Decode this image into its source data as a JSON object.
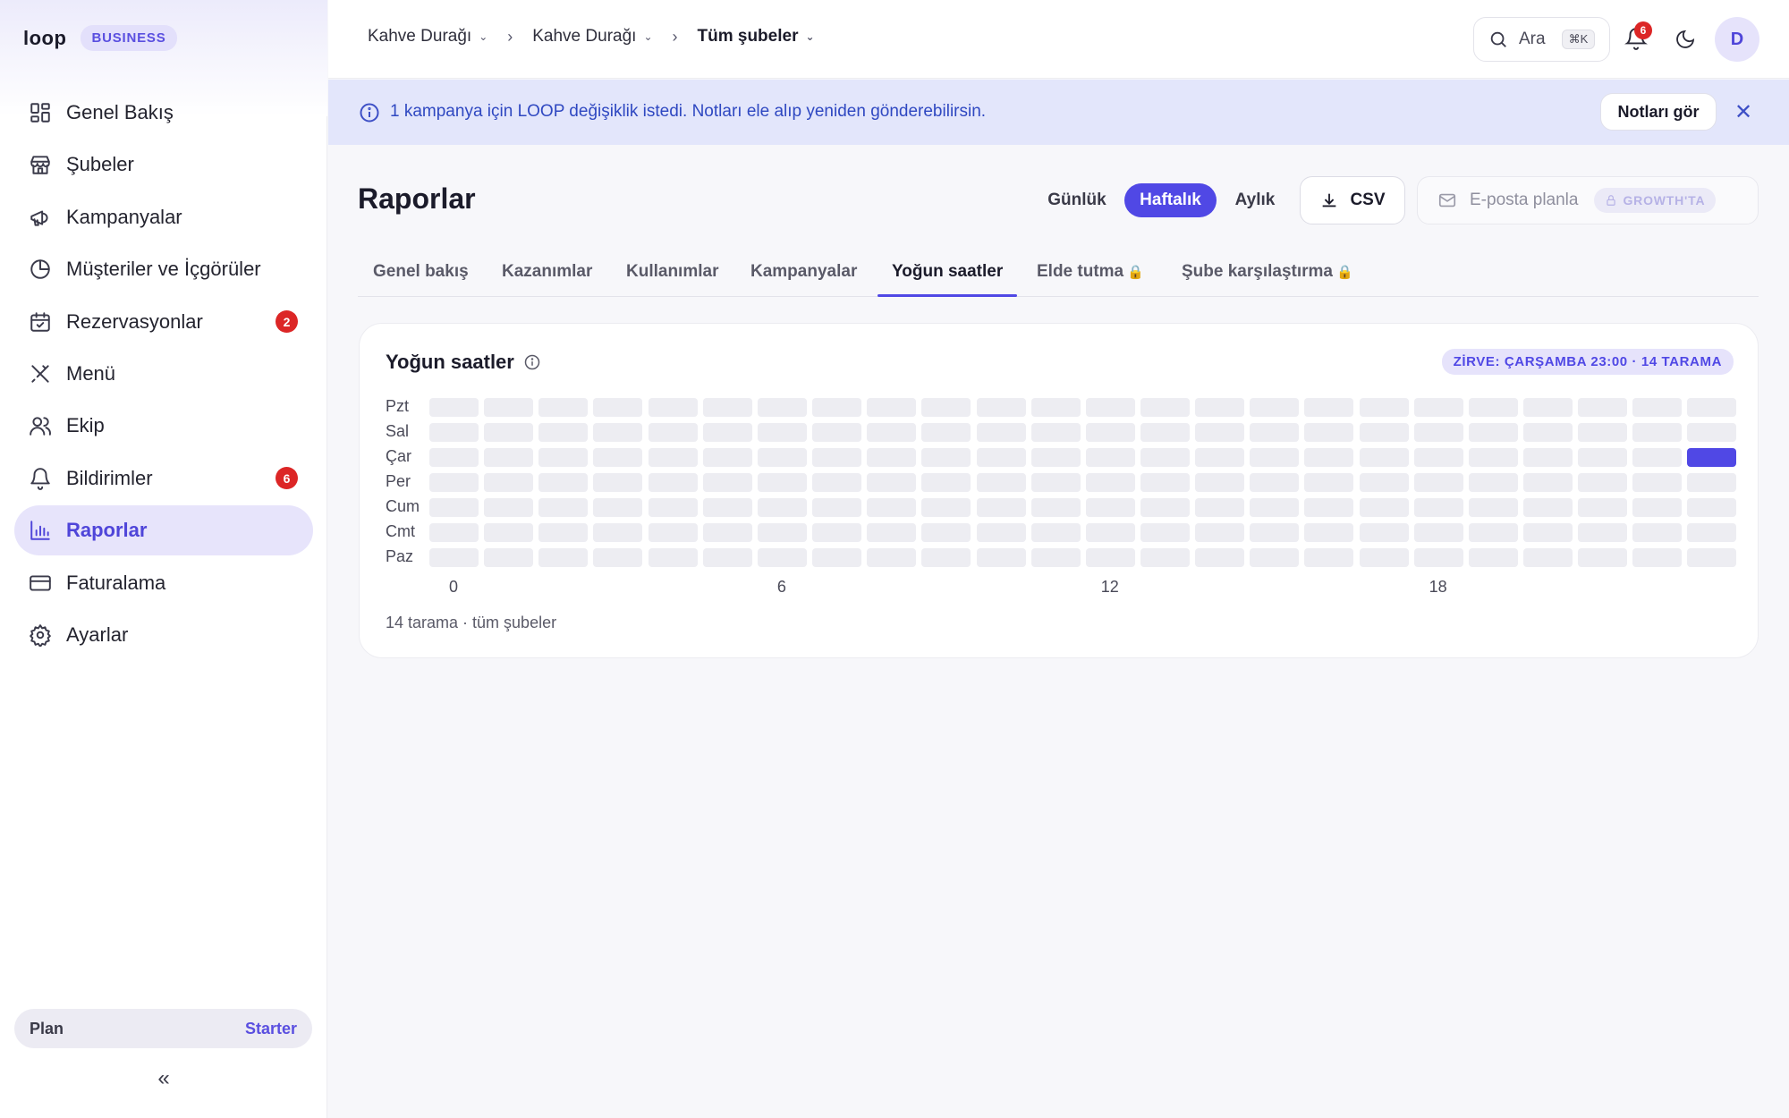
{
  "sidebar": {
    "logo": "loop",
    "badge": "BUSINESS",
    "items": [
      {
        "label": "Genel Bakış",
        "icon": "grid-icon"
      },
      {
        "label": "Şubeler",
        "icon": "store-icon"
      },
      {
        "label": "Kampanyalar",
        "icon": "megaphone-icon"
      },
      {
        "label": "Müşteriler ve İçgörüler",
        "icon": "pie-chart-icon"
      },
      {
        "label": "Rezervasyonlar",
        "icon": "calendar-check-icon",
        "badge": "2"
      },
      {
        "label": "Menü",
        "icon": "utensils-icon"
      },
      {
        "label": "Ekip",
        "icon": "users-icon"
      },
      {
        "label": "Bildirimler",
        "icon": "bell-icon",
        "badge": "6"
      },
      {
        "label": "Raporlar",
        "icon": "bar-chart-icon",
        "active": true
      },
      {
        "label": "Faturalama",
        "icon": "credit-card-icon"
      },
      {
        "label": "Ayarlar",
        "icon": "gear-icon"
      }
    ],
    "plan_label": "Plan",
    "plan_value": "Starter",
    "collapse": "«"
  },
  "topbar": {
    "breadcrumbs": [
      "Kahve Durağı",
      "Kahve Durağı",
      "Tüm şubeler"
    ],
    "search_label": "Ara",
    "search_shortcut": "⌘K",
    "notifications_count": "6",
    "avatar_initial": "D"
  },
  "banner": {
    "text": "1 kampanya için LOOP değişiklik istedi. Notları ele alıp yeniden gönderebilirsin.",
    "button": "Notları gör"
  },
  "page": {
    "title": "Raporlar",
    "periods": [
      "Günlük",
      "Haftalık",
      "Aylık"
    ],
    "active_period": "Haftalık",
    "csv_label": "CSV",
    "email_label": "E-posta planla",
    "email_badge": "GROWTH'TA",
    "tabs": [
      "Genel bakış",
      "Kazanımlar",
      "Kullanımlar",
      "Kampanyalar",
      "Yoğun saatler",
      "Elde tutma",
      "Şube karşılaştırma"
    ],
    "active_tab": "Yoğun saatler",
    "locked_tabs": [
      "Elde tutma",
      "Şube karşılaştırma"
    ]
  },
  "card": {
    "title": "Yoğun saatler",
    "peak": "ZİRVE: ÇARŞAMBA 23:00 · 14 TARAMA",
    "footer": "14 tarama · tüm şubeler"
  },
  "colors": {
    "accent": "#5048e5",
    "empty_cell": "#ededf2",
    "badge_red": "#dc2626"
  },
  "chart_data": {
    "type": "heatmap",
    "title": "Yoğun saatler",
    "rows": [
      "Pzt",
      "Sal",
      "Çar",
      "Per",
      "Cum",
      "Cmt",
      "Paz"
    ],
    "columns": [
      0,
      1,
      2,
      3,
      4,
      5,
      6,
      7,
      8,
      9,
      10,
      11,
      12,
      13,
      14,
      15,
      16,
      17,
      18,
      19,
      20,
      21,
      22,
      23
    ],
    "tick_labels": [
      "0",
      "6",
      "12",
      "18"
    ],
    "tick_values": [
      0,
      6,
      12,
      18
    ],
    "values": [
      [
        0,
        0,
        0,
        0,
        0,
        0,
        0,
        0,
        0,
        0,
        0,
        0,
        0,
        0,
        0,
        0,
        0,
        0,
        0,
        0,
        0,
        0,
        0,
        0
      ],
      [
        0,
        0,
        0,
        0,
        0,
        0,
        0,
        0,
        0,
        0,
        0,
        0,
        0,
        0,
        0,
        0,
        0,
        0,
        0,
        0,
        0,
        0,
        0,
        0
      ],
      [
        0,
        0,
        0,
        0,
        0,
        0,
        0,
        0,
        0,
        0,
        0,
        0,
        0,
        0,
        0,
        0,
        0,
        0,
        0,
        0,
        0,
        0,
        0,
        14
      ],
      [
        0,
        0,
        0,
        0,
        0,
        0,
        0,
        0,
        0,
        0,
        0,
        0,
        0,
        0,
        0,
        0,
        0,
        0,
        0,
        0,
        0,
        0,
        0,
        0
      ],
      [
        0,
        0,
        0,
        0,
        0,
        0,
        0,
        0,
        0,
        0,
        0,
        0,
        0,
        0,
        0,
        0,
        0,
        0,
        0,
        0,
        0,
        0,
        0,
        0
      ],
      [
        0,
        0,
        0,
        0,
        0,
        0,
        0,
        0,
        0,
        0,
        0,
        0,
        0,
        0,
        0,
        0,
        0,
        0,
        0,
        0,
        0,
        0,
        0,
        0
      ],
      [
        0,
        0,
        0,
        0,
        0,
        0,
        0,
        0,
        0,
        0,
        0,
        0,
        0,
        0,
        0,
        0,
        0,
        0,
        0,
        0,
        0,
        0,
        0,
        0
      ]
    ]
  }
}
